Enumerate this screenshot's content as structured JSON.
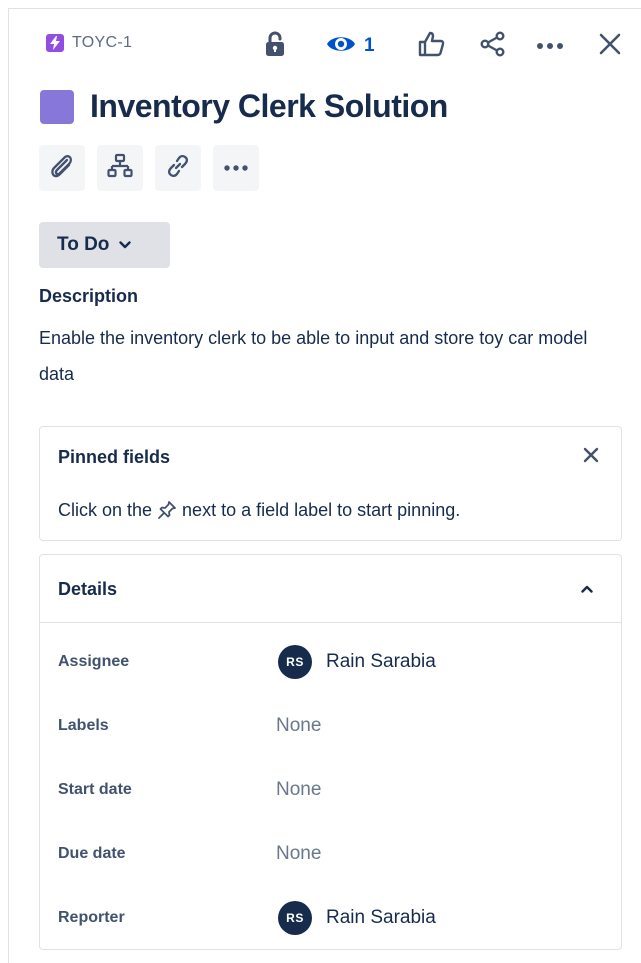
{
  "header": {
    "issue_key": "TOYC-1",
    "watch_count": "1",
    "icons": [
      "lightning-icon",
      "lock-icon",
      "eye-icon",
      "thumbs-up-icon",
      "share-icon",
      "more-icon",
      "close-icon"
    ]
  },
  "issue": {
    "title": "Inventory Clerk Solution",
    "status": "To Do",
    "description_heading": "Description",
    "description": "Enable the inventory clerk to be able to input and store toy car model data"
  },
  "quick_actions": [
    "attach-icon",
    "child-issue-icon",
    "link-icon",
    "more-icon"
  ],
  "pinned": {
    "title": "Pinned fields",
    "hint_before": "Click on the",
    "hint_after": "next to a field label to start pinning."
  },
  "details": {
    "title": "Details",
    "fields": {
      "assignee": {
        "label": "Assignee",
        "initials": "RS",
        "name": "Rain Sarabia"
      },
      "labels": {
        "label": "Labels",
        "value": "None"
      },
      "start_date": {
        "label": "Start date",
        "value": "None"
      },
      "due_date": {
        "label": "Due date",
        "value": "None"
      },
      "reporter": {
        "label": "Reporter",
        "initials": "RS",
        "name": "Rain Sarabia"
      }
    }
  },
  "colors": {
    "brand_blue": "#0052cc",
    "epic_purple": "#8777d9",
    "text_primary": "#172b4d",
    "text_subtle": "#6b778c"
  }
}
